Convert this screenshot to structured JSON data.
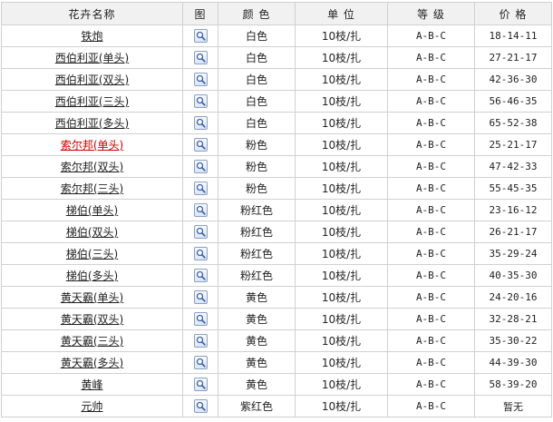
{
  "headers": {
    "name": "花卉名称",
    "image": "图",
    "color": "颜 色",
    "unit": "单 位",
    "grade": "等 级",
    "price": "价 格"
  },
  "rows": [
    {
      "name": "铁炮",
      "color": "白色",
      "unit": "10枝/扎",
      "grade": "A-B-C",
      "price": "18-14-11",
      "highlight": false
    },
    {
      "name": "西伯利亚(单头)",
      "color": "白色",
      "unit": "10枝/扎",
      "grade": "A-B-C",
      "price": "27-21-17",
      "highlight": false
    },
    {
      "name": "西伯利亚(双头)",
      "color": "白色",
      "unit": "10枝/扎",
      "grade": "A-B-C",
      "price": "42-36-30",
      "highlight": false
    },
    {
      "name": "西伯利亚(三头)",
      "color": "白色",
      "unit": "10枝/扎",
      "grade": "A-B-C",
      "price": "56-46-35",
      "highlight": false
    },
    {
      "name": "西伯利亚(多头)",
      "color": "白色",
      "unit": "10枝/扎",
      "grade": "A-B-C",
      "price": "65-52-38",
      "highlight": false
    },
    {
      "name": "索尔邦(单头)",
      "color": "粉色",
      "unit": "10枝/扎",
      "grade": "A-B-C",
      "price": "25-21-17",
      "highlight": true
    },
    {
      "name": "索尔邦(双头)",
      "color": "粉色",
      "unit": "10枝/扎",
      "grade": "A-B-C",
      "price": "47-42-33",
      "highlight": false
    },
    {
      "name": "索尔邦(三头)",
      "color": "粉色",
      "unit": "10枝/扎",
      "grade": "A-B-C",
      "price": "55-45-35",
      "highlight": false
    },
    {
      "name": "梯伯(单头)",
      "color": "粉红色",
      "unit": "10枝/扎",
      "grade": "A-B-C",
      "price": "23-16-12",
      "highlight": false
    },
    {
      "name": "梯伯(双头)",
      "color": "粉红色",
      "unit": "10枝/扎",
      "grade": "A-B-C",
      "price": "26-21-17",
      "highlight": false
    },
    {
      "name": "梯伯(三头)",
      "color": "粉红色",
      "unit": "10枝/扎",
      "grade": "A-B-C",
      "price": "35-29-24",
      "highlight": false
    },
    {
      "name": "梯伯(多头)",
      "color": "粉红色",
      "unit": "10枝/扎",
      "grade": "A-B-C",
      "price": "40-35-30",
      "highlight": false
    },
    {
      "name": "黄天霸(单头)",
      "color": "黄色",
      "unit": "10枝/扎",
      "grade": "A-B-C",
      "price": "24-20-16",
      "highlight": false
    },
    {
      "name": "黄天霸(双头)",
      "color": "黄色",
      "unit": "10枝/扎",
      "grade": "A-B-C",
      "price": "32-28-21",
      "highlight": false
    },
    {
      "name": "黄天霸(三头)",
      "color": "黄色",
      "unit": "10枝/扎",
      "grade": "A-B-C",
      "price": "35-30-22",
      "highlight": false
    },
    {
      "name": "黄天霸(多头)",
      "color": "黄色",
      "unit": "10枝/扎",
      "grade": "A-B-C",
      "price": "44-39-30",
      "highlight": false
    },
    {
      "name": "黄峰",
      "color": "黄色",
      "unit": "10枝/扎",
      "grade": "A-B-C",
      "price": "58-39-20",
      "highlight": false
    },
    {
      "name": "元帅",
      "color": "紫红色",
      "unit": "10枝/扎",
      "grade": "A-B-C",
      "price": "暂无",
      "highlight": false
    }
  ],
  "row_icon": "magnifier-icon",
  "colors": {
    "link": "#222222",
    "highlight_link": "#cc0000",
    "header_bg": "#f1f1f1",
    "border": "#d0d0d0"
  }
}
